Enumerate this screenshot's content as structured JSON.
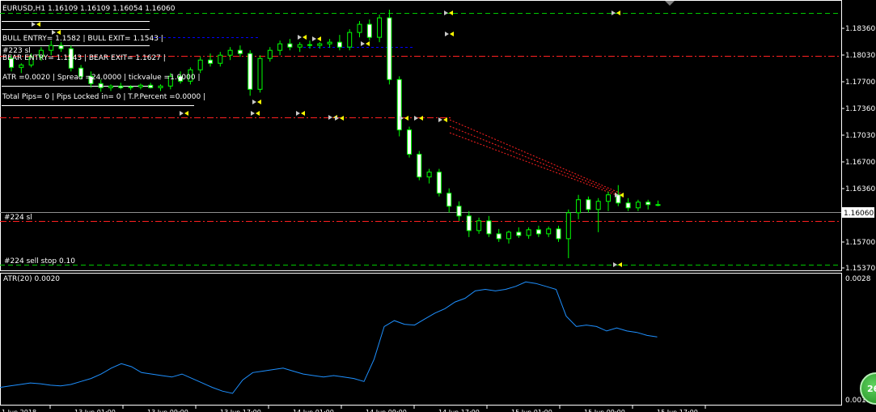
{
  "title": "EURUSD,H1 1.16109 1.16109 1.16054 1.16060",
  "info_lines": [
    "BULL ENTRY= 1.1582 | BULL EXIT= 1.1543 |",
    "BEAR ENTRY= 1.1543 | BEAR EXIT= 1.1627 |",
    "ATR =0.0020 | Spread =24.0000 | tickvalue =1.0000 |",
    "Total Pips= 0 | Pips Locked in= 0 | T.P.Percent =0.0000 |"
  ],
  "overlay_labels": {
    "sl_223": "#223 sl",
    "sl_224": "#224 sl",
    "sell_stop_224": "#224 sell stop 0.10"
  },
  "price_axis": {
    "ticks": [
      "1.18360",
      "1.18030",
      "1.17700",
      "1.17360",
      "1.17030",
      "1.16700",
      "1.16360",
      "1.16060",
      "1.15700",
      "1.15370"
    ],
    "current_price": "1.16060"
  },
  "indicator": {
    "label": "ATR(20) 0.0020",
    "ticks": [
      "0.0028",
      "0.0011"
    ]
  },
  "time_axis": {
    "labels": [
      "1 Jun 2018",
      "13 Jun 01:00",
      "13 Jun 09:00",
      "13 Jun 17:00",
      "14 Jun 01:00",
      "14 Jun 09:00",
      "14 Jun 17:00",
      "15 Jun 01:00",
      "15 Jun 09:00",
      "15 Jun 17:00"
    ]
  },
  "badge_text": "26",
  "colors": {
    "background": "#000000",
    "bull_candle": "#00ff00",
    "bear_candle": "#ffffff",
    "atr_line": "#1e90ff",
    "green_dash": "#00c800",
    "red_dash": "#ff0000",
    "blue_dash": "#0000ff"
  },
  "chart_data": {
    "type": "candlestick",
    "price_range": [
      1.1527,
      1.1852
    ],
    "candles": [
      [
        1.1786,
        1.179,
        1.177,
        1.1775
      ],
      [
        1.1775,
        1.178,
        1.1768,
        1.1778
      ],
      [
        1.1778,
        1.1792,
        1.1775,
        1.1788
      ],
      [
        1.1788,
        1.18,
        1.1783,
        1.1796
      ],
      [
        1.1796,
        1.1808,
        1.179,
        1.1802
      ],
      [
        1.1802,
        1.1806,
        1.1794,
        1.1798
      ],
      [
        1.1798,
        1.1802,
        1.177,
        1.1774
      ],
      [
        1.1774,
        1.1778,
        1.176,
        1.1764
      ],
      [
        1.1764,
        1.177,
        1.175,
        1.1755
      ],
      [
        1.1755,
        1.176,
        1.1745,
        1.175
      ],
      [
        1.175,
        1.1754,
        1.1746,
        1.1752
      ],
      [
        1.1752,
        1.1756,
        1.1748,
        1.175
      ],
      [
        1.175,
        1.1753,
        1.1747,
        1.1751
      ],
      [
        1.1751,
        1.1755,
        1.1748,
        1.1753
      ],
      [
        1.1753,
        1.1756,
        1.1749,
        1.175
      ],
      [
        1.175,
        1.1754,
        1.1746,
        1.1752
      ],
      [
        1.1752,
        1.1768,
        1.1748,
        1.1764
      ],
      [
        1.1764,
        1.177,
        1.1755,
        1.1758
      ],
      [
        1.1758,
        1.1775,
        1.1754,
        1.1772
      ],
      [
        1.1772,
        1.1788,
        1.1768,
        1.1784
      ],
      [
        1.1784,
        1.1792,
        1.1776,
        1.178
      ],
      [
        1.178,
        1.1794,
        1.1776,
        1.179
      ],
      [
        1.179,
        1.18,
        1.1784,
        1.1796
      ],
      [
        1.1796,
        1.1802,
        1.1788,
        1.1792
      ],
      [
        1.1792,
        1.1796,
        1.174,
        1.1748
      ],
      [
        1.1748,
        1.179,
        1.1744,
        1.1786
      ],
      [
        1.1786,
        1.18,
        1.1782,
        1.1796
      ],
      [
        1.1796,
        1.1808,
        1.179,
        1.1804
      ],
      [
        1.1804,
        1.181,
        1.1796,
        1.18
      ],
      [
        1.18,
        1.1806,
        1.1794,
        1.1803
      ],
      [
        1.1803,
        1.1808,
        1.1798,
        1.1802
      ],
      [
        1.1802,
        1.1806,
        1.1798,
        1.1804
      ],
      [
        1.1804,
        1.181,
        1.1799,
        1.1806
      ],
      [
        1.1806,
        1.1815,
        1.1796,
        1.18
      ],
      [
        1.18,
        1.1822,
        1.1796,
        1.1818
      ],
      [
        1.1818,
        1.1832,
        1.1812,
        1.1828
      ],
      [
        1.1828,
        1.1834,
        1.1808,
        1.1812
      ],
      [
        1.1812,
        1.184,
        1.1806,
        1.1836
      ],
      [
        1.1836,
        1.1846,
        1.1754,
        1.176
      ],
      [
        1.176,
        1.1764,
        1.169,
        1.1698
      ],
      [
        1.1698,
        1.1702,
        1.1664,
        1.1668
      ],
      [
        1.1668,
        1.1672,
        1.1636,
        1.164
      ],
      [
        1.164,
        1.165,
        1.1632,
        1.1646
      ],
      [
        1.1646,
        1.165,
        1.1616,
        1.162
      ],
      [
        1.162,
        1.1626,
        1.1596,
        1.1604
      ],
      [
        1.1604,
        1.161,
        1.1586,
        1.1592
      ],
      [
        1.1592,
        1.1598,
        1.1566,
        1.1574
      ],
      [
        1.1574,
        1.159,
        1.157,
        1.1586
      ],
      [
        1.1586,
        1.1592,
        1.1566,
        1.157
      ],
      [
        1.157,
        1.1576,
        1.156,
        1.1564
      ],
      [
        1.1564,
        1.1574,
        1.1558,
        1.1572
      ],
      [
        1.1572,
        1.1578,
        1.1565,
        1.1568
      ],
      [
        1.1568,
        1.1578,
        1.1564,
        1.1575
      ],
      [
        1.1575,
        1.158,
        1.1566,
        1.157
      ],
      [
        1.157,
        1.1579,
        1.1566,
        1.1576
      ],
      [
        1.1576,
        1.158,
        1.156,
        1.1564
      ],
      [
        1.1564,
        1.16,
        1.154,
        1.1596
      ],
      [
        1.1596,
        1.1618,
        1.1588,
        1.1612
      ],
      [
        1.1612,
        1.1616,
        1.1596,
        1.16
      ],
      [
        1.16,
        1.1614,
        1.1572,
        1.161
      ],
      [
        1.161,
        1.1622,
        1.1598,
        1.1618
      ],
      [
        1.1618,
        1.163,
        1.1604,
        1.1608
      ],
      [
        1.1608,
        1.1614,
        1.1598,
        1.1602
      ],
      [
        1.1602,
        1.1612,
        1.1598,
        1.1609
      ],
      [
        1.1609,
        1.1612,
        1.16,
        1.1606
      ],
      [
        1.1606,
        1.1611,
        1.1604,
        1.1606
      ]
    ],
    "atr_values": [
      0.0013,
      0.00132,
      0.00134,
      0.00136,
      0.00135,
      0.00133,
      0.00132,
      0.00134,
      0.00138,
      0.00142,
      0.00148,
      0.00156,
      0.00162,
      0.00158,
      0.0015,
      0.00148,
      0.00146,
      0.00144,
      0.00148,
      0.00142,
      0.00136,
      0.0013,
      0.00125,
      0.00122,
      0.0014,
      0.0015,
      0.00152,
      0.00154,
      0.00156,
      0.00152,
      0.00148,
      0.00146,
      0.00144,
      0.00146,
      0.00144,
      0.00142,
      0.00138,
      0.00168,
      0.00212,
      0.0022,
      0.00215,
      0.00214,
      0.00222,
      0.0023,
      0.00236,
      0.00245,
      0.0025,
      0.0026,
      0.00262,
      0.0026,
      0.00262,
      0.00266,
      0.00272,
      0.0027,
      0.00266,
      0.00262,
      0.00226,
      0.00212,
      0.00214,
      0.00212,
      0.00206,
      0.0021,
      0.00206,
      0.00204,
      0.002,
      0.00198
    ],
    "atr_range": [
      0.0011,
      0.0028
    ]
  }
}
